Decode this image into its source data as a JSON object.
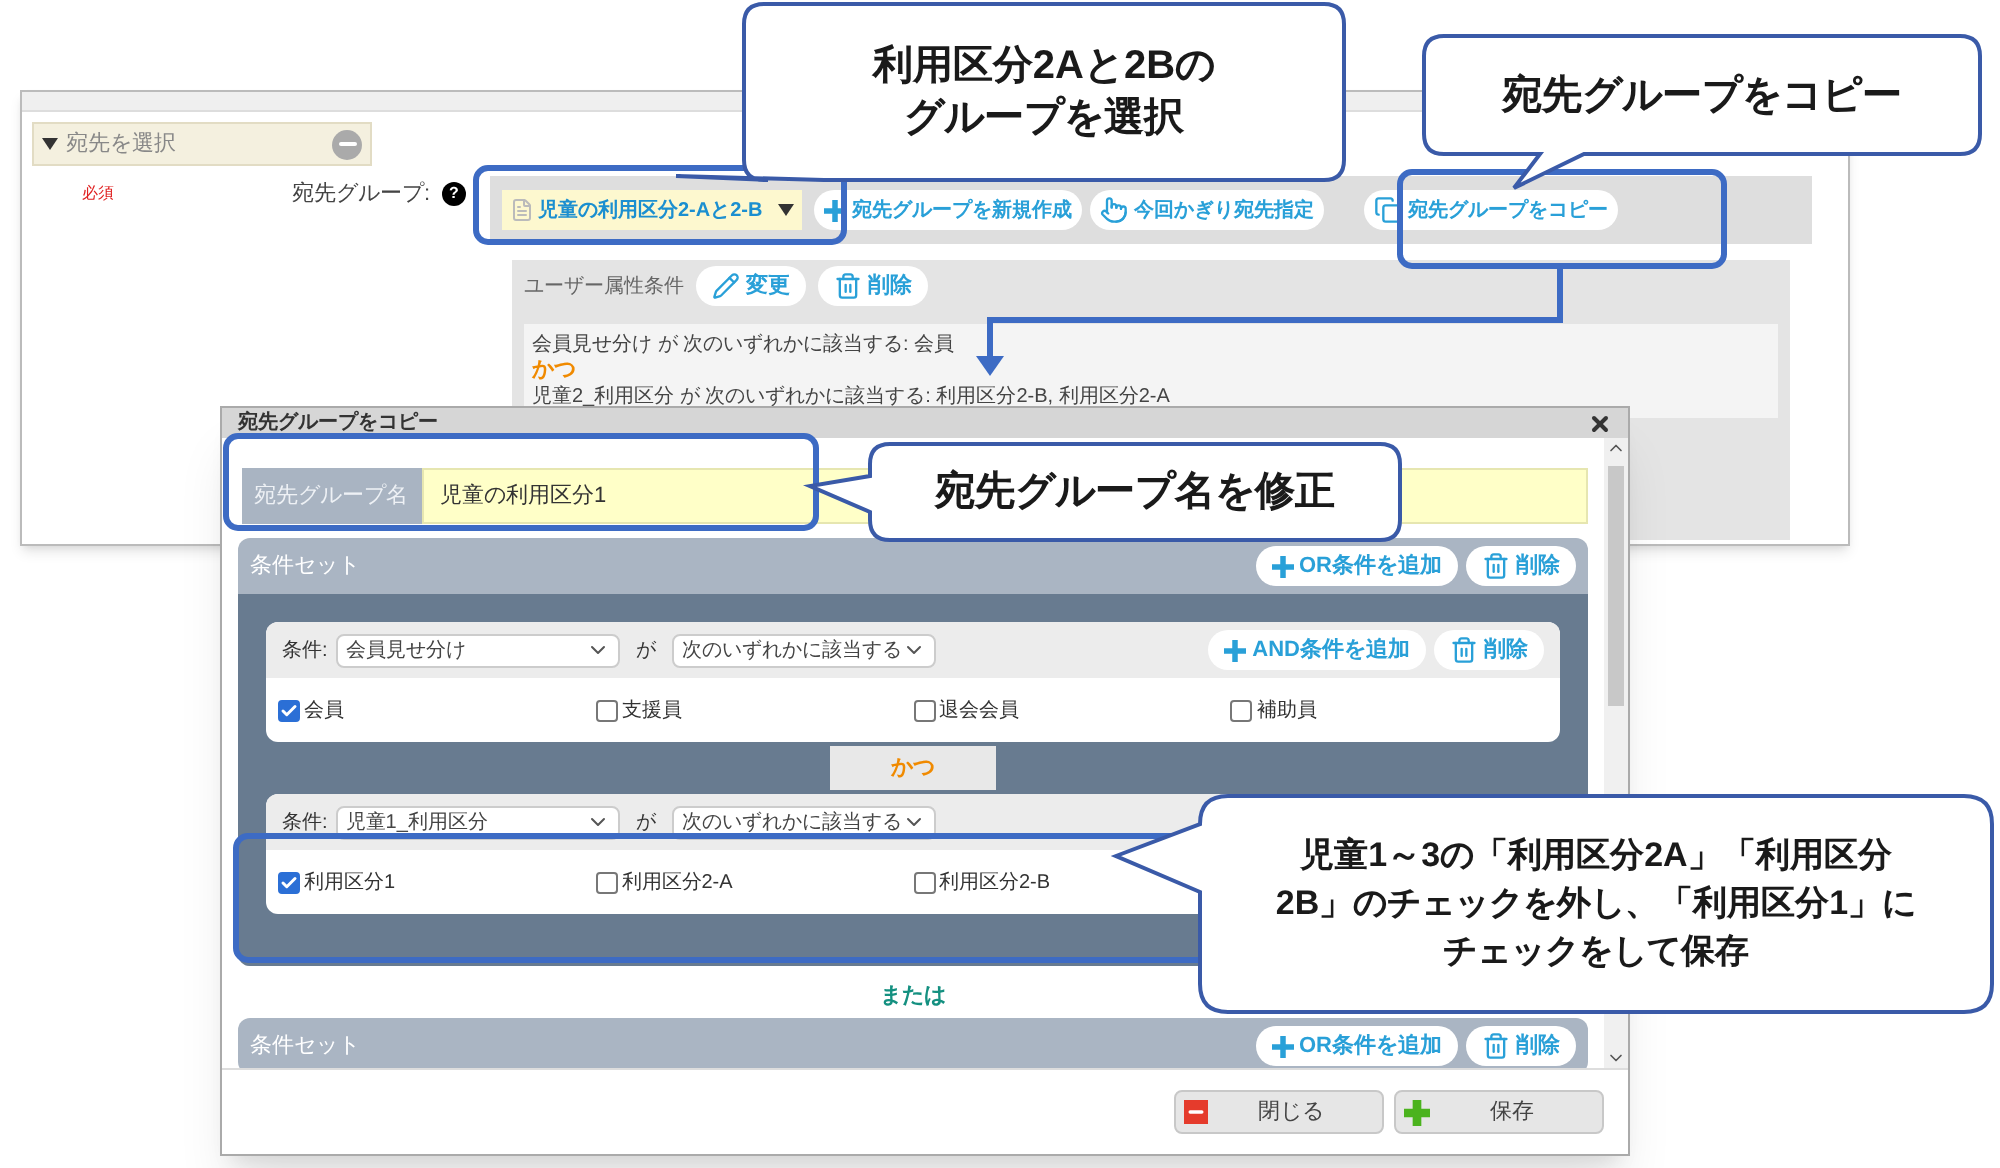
{
  "back_window": {
    "section": {
      "title": "宛先を選択",
      "expanded": true
    },
    "required_label": "必須",
    "field_label": "宛先グループ:",
    "help": "?",
    "group_dropdown": "児童の利用区分2-Aと2-B",
    "toolbar_buttons": [
      {
        "kind": "new",
        "label": "宛先グループを新規作成"
      },
      {
        "kind": "once",
        "label": "今回かぎり宛先指定"
      },
      {
        "kind": "copy",
        "label": "宛先グループをコピー"
      }
    ],
    "conditions_panel": {
      "title": "ユーザー属性条件",
      "buttons": [
        {
          "kind": "edit",
          "label": "変更"
        },
        {
          "kind": "delete",
          "label": "削除"
        }
      ],
      "lines": [
        {
          "kind": "text",
          "text": "会員見せ分け が 次のいずれかに該当する: 会員"
        },
        {
          "kind": "and",
          "text": "かつ"
        },
        {
          "kind": "text",
          "text": "児童2_利用区分 が 次のいずれかに該当する: 利用区分2-B, 利用区分2-A"
        }
      ]
    }
  },
  "dialog": {
    "title": "宛先グループをコピー",
    "name_label": "宛先グループ名",
    "name_value": "児童の利用区分1",
    "condition_sets": [
      {
        "title": "条件セット",
        "buttons": [
          {
            "kind": "add",
            "label": "OR条件を追加"
          },
          {
            "kind": "delete",
            "label": "削除"
          }
        ],
        "blocks": [
          {
            "field_label": "条件:",
            "field": "会員見せ分け",
            "connector": "が",
            "operator": "次のいずれかに該当する",
            "buttons": [
              {
                "kind": "add",
                "label": "AND条件を追加"
              },
              {
                "kind": "delete",
                "label": "削除"
              }
            ],
            "options": [
              {
                "label": "会員",
                "checked": true
              },
              {
                "label": "支援員",
                "checked": false
              },
              {
                "label": "退会会員",
                "checked": false
              },
              {
                "label": "補助員",
                "checked": false
              }
            ]
          },
          {
            "joined_by": "かつ",
            "field_label": "条件:",
            "field": "児童1_利用区分",
            "connector": "が",
            "operator": "次のいずれかに該当する",
            "options": [
              {
                "label": "利用区分1",
                "checked": true
              },
              {
                "label": "利用区分2-A",
                "checked": false
              },
              {
                "label": "利用区分2-B",
                "checked": false
              }
            ]
          }
        ]
      },
      {
        "joined_by": "または",
        "title": "条件セット",
        "buttons": [
          {
            "kind": "add",
            "label": "OR条件を追加"
          },
          {
            "kind": "delete",
            "label": "削除"
          }
        ]
      }
    ],
    "footer_buttons": [
      {
        "kind": "close",
        "label": "閉じる"
      },
      {
        "kind": "save",
        "label": "保存"
      }
    ]
  },
  "callouts": [
    {
      "lines": [
        "利用区分2Aと2Bの",
        "グループを選択"
      ]
    },
    {
      "lines": [
        "宛先グループをコピー"
      ]
    },
    {
      "lines": [
        "宛先グループ名を修正"
      ]
    },
    {
      "lines": [
        "児童1～3の「利用区分2A」「利用区分",
        "2B」のチェックを外し、「利用区分1」に",
        "チェックをして保存"
      ]
    }
  ]
}
